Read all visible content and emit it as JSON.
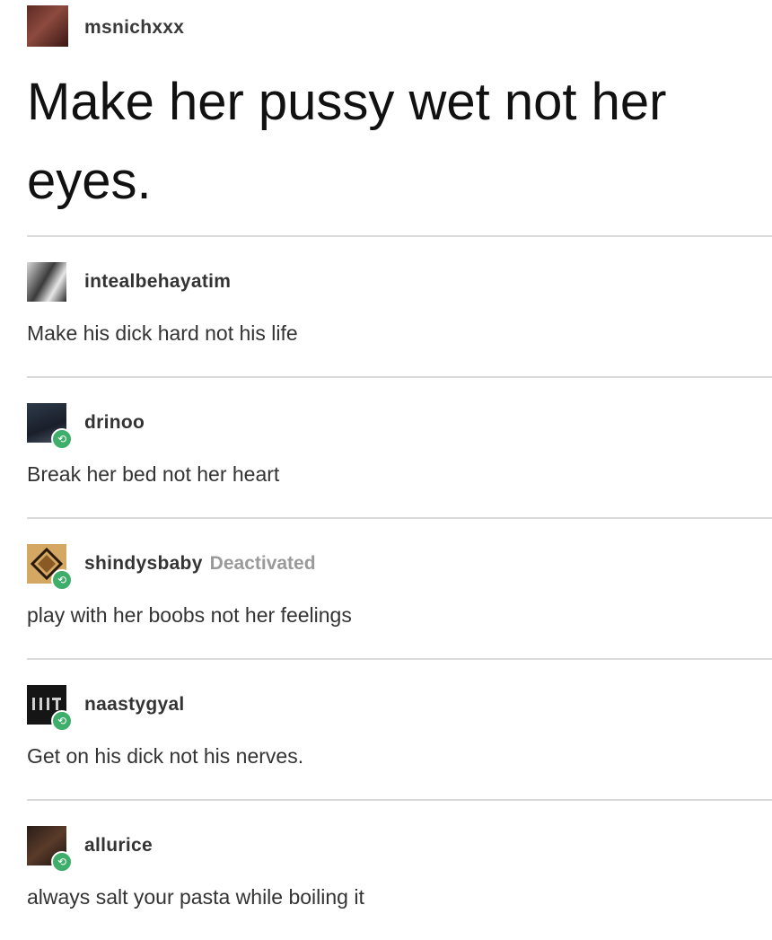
{
  "original_post": {
    "username": "msnichxxx",
    "text": "Make her pussy wet not her eyes."
  },
  "replies": [
    {
      "username": "intealbehayatim",
      "text": "Make his dick hard not his life",
      "has_badge": false
    },
    {
      "username": "drinoo",
      "text": "Break her bed not her heart",
      "has_badge": true
    },
    {
      "username": "shindysbaby",
      "status": "Deactivated",
      "text": "play with her boobs not her feelings",
      "has_badge": true
    },
    {
      "username": "naastygyal",
      "text": "Get on his dick not his nerves.",
      "has_badge": true
    },
    {
      "username": "allurice",
      "text": "always salt your pasta while boiling it",
      "has_badge": true
    }
  ],
  "icons": {
    "badge": "reblog-badge-icon"
  },
  "colors": {
    "badge": "#3fae6a",
    "divider": "#dadada",
    "deactivated": "#9a9a9a"
  }
}
